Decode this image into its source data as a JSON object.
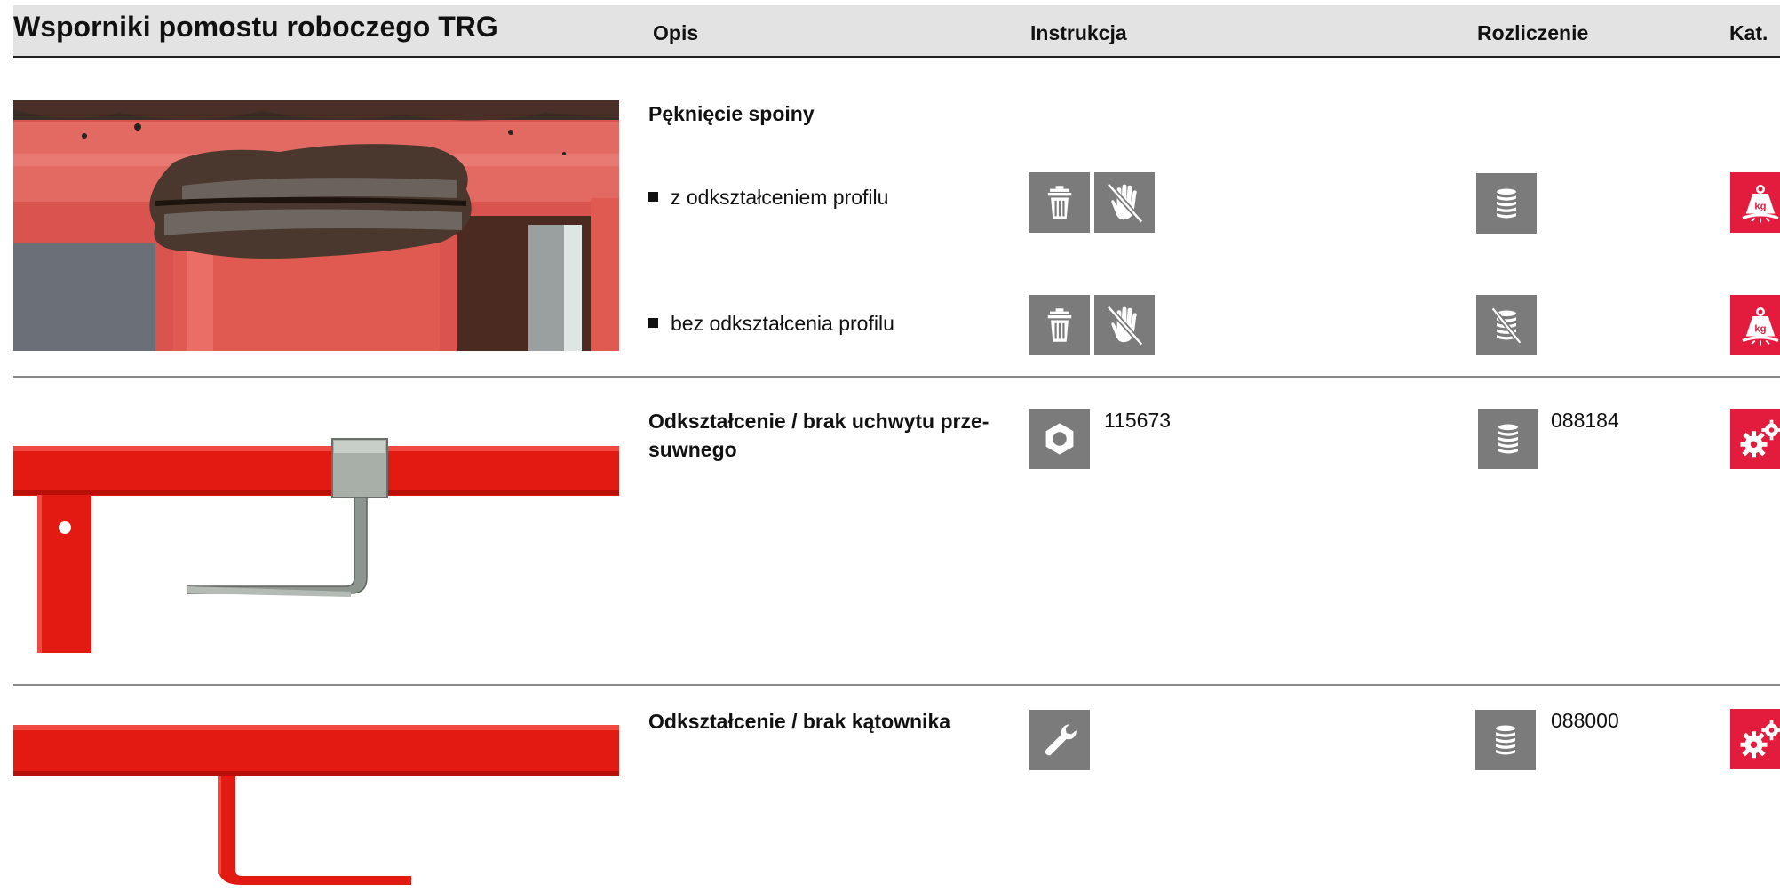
{
  "header": {
    "title": "Wsporniki pomostu roboczego TRG",
    "col_description": "Opis",
    "col_instruction": "Instrukcja",
    "col_settlement": "Rozliczenie",
    "col_category": "Kat."
  },
  "rows": [
    {
      "title": "Pęknięcie spoiny",
      "subitems": [
        {
          "label": "z odkształceniem profilu",
          "instruction_icons": [
            "trash-icon",
            "no-hand-repair-icon"
          ],
          "settlement_icon": "stack-icon",
          "category_icon": "weight-kg-icon"
        },
        {
          "label": "bez odkształcenia profilu",
          "instruction_icons": [
            "trash-icon",
            "no-hand-repair-icon"
          ],
          "settlement_icon": "stack-crossed-icon",
          "category_icon": "weight-kg-icon"
        }
      ]
    },
    {
      "title": "Odkształcenie / brak uchwytu prze-suwnego",
      "title_line1": "Odkształcenie / brak uchwytu prze-",
      "title_line2": "suwnego",
      "instruction_icon": "hex-nut-icon",
      "instruction_code": "115673",
      "settlement_icon": "stack-icon",
      "settlement_code": "088184",
      "category_icon": "gears-icon"
    },
    {
      "title": "Odkształcenie / brak kątownika",
      "instruction_icon": "wrench-icon",
      "settlement_icon": "stack-icon",
      "settlement_code": "088000",
      "category_icon": "gears-icon"
    }
  ],
  "colors": {
    "header_bg": "#e3e3e3",
    "icon_gray": "#7b7b7b",
    "icon_red": "#e31b3d",
    "bracket_red": "#e31a12"
  }
}
